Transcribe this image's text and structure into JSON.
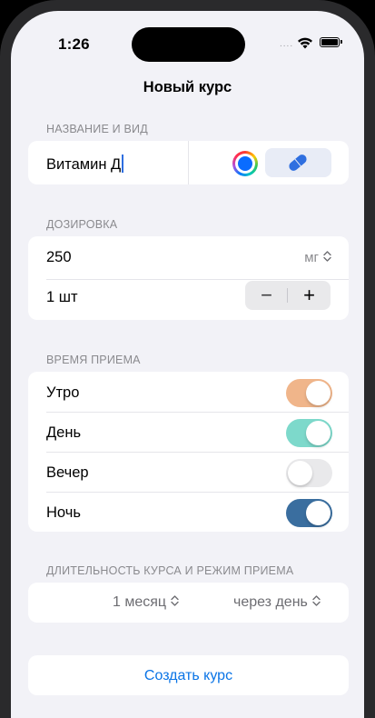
{
  "status_bar": {
    "time": "1:26",
    "signal": "....",
    "icons": [
      "wifi-icon",
      "battery-icon"
    ]
  },
  "nav": {
    "title": "Новый курс"
  },
  "name_section": {
    "label": "НАЗВАНИЕ И ВИД",
    "name_value": "Витамин Д",
    "color_selected": "#0a6cff",
    "form_icon": "pill-icon",
    "form_icon_color": "#2f6fe0"
  },
  "dosage_section": {
    "label": "ДОЗИРОВКА",
    "amount": "250",
    "unit": "мг",
    "unit_chevron": "⌃⌄",
    "quantity": "1 шт",
    "minus": "−",
    "plus": "+"
  },
  "time_section": {
    "label": "ВРЕМЯ ПРИЕМА",
    "items": [
      {
        "label": "Утро",
        "on": true,
        "color": "#f0b58a"
      },
      {
        "label": "День",
        "on": true,
        "color": "#7dd9cb"
      },
      {
        "label": "Вечер",
        "on": false,
        "color": "#e9e9eb"
      },
      {
        "label": "Ночь",
        "on": true,
        "color": "#3a6e9f"
      }
    ]
  },
  "duration_section": {
    "label": "ДЛИТЕЛЬНОСТЬ КУРСА И РЕЖИМ ПРИЕМА",
    "duration": "1 месяц",
    "mode": "через день",
    "chevron": "⌃⌄"
  },
  "actions": {
    "create_label": "Создать курс"
  },
  "colors": {
    "background": "#f2f2f7",
    "card": "#ffffff",
    "accent": "#0a74e6"
  }
}
